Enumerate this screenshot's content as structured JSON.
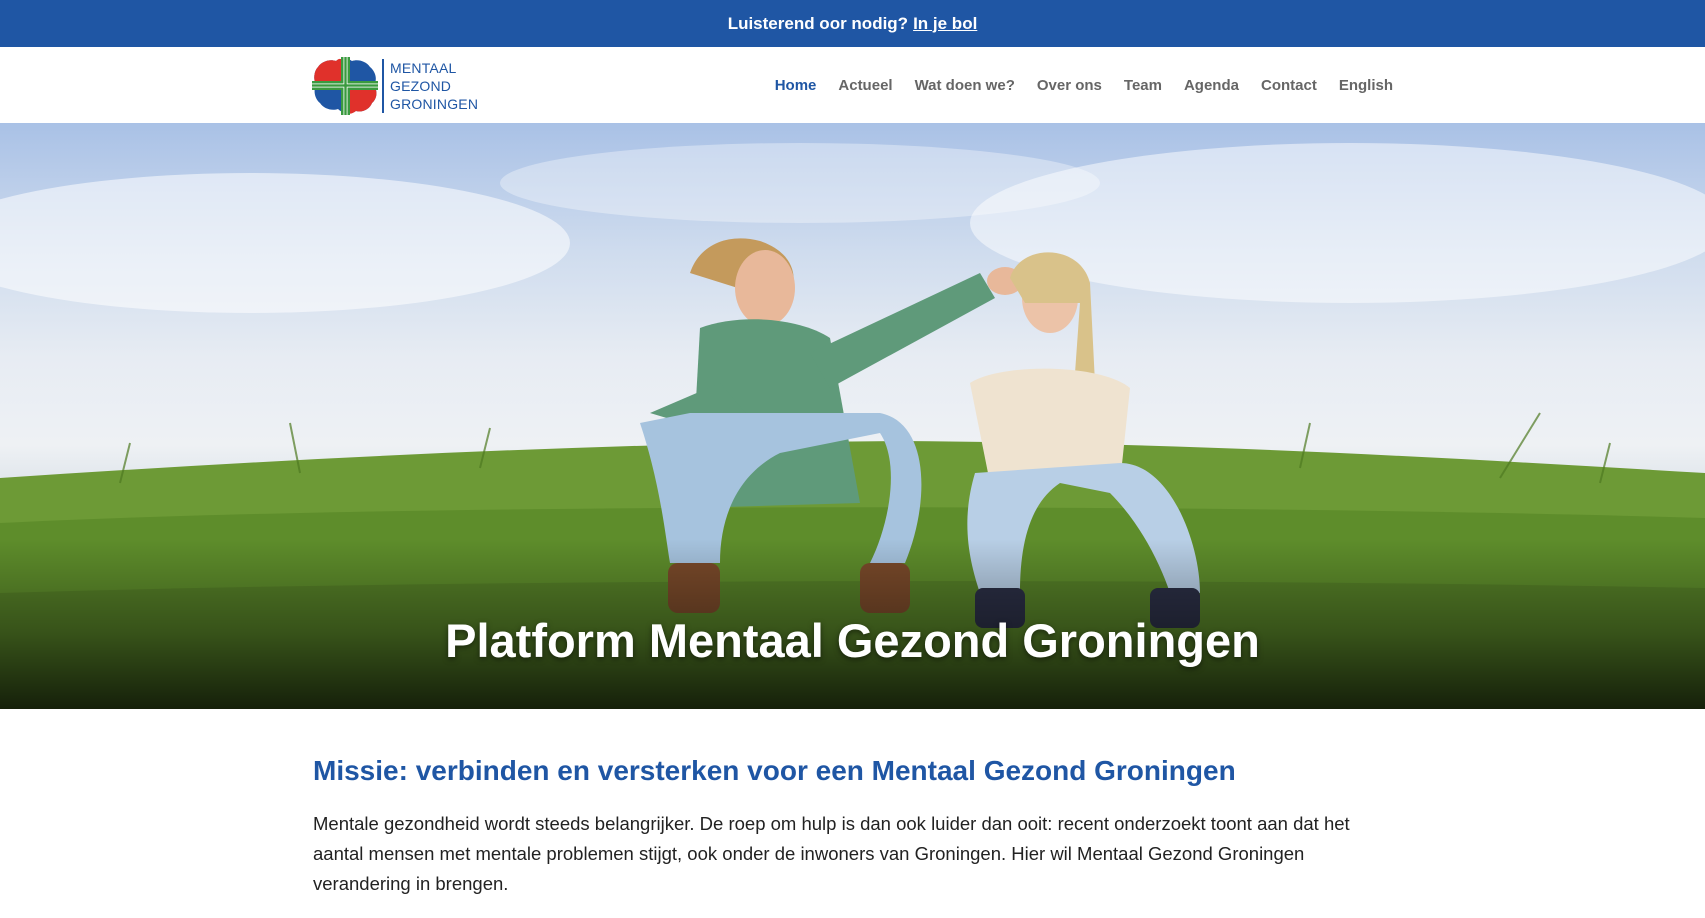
{
  "topbar": {
    "text": "Luisterend oor nodig?",
    "link_label": "In je bol"
  },
  "logo": {
    "line1": "MENTAAL",
    "line2": "GEZOND",
    "line3": "GRONINGEN",
    "colors": {
      "red": "#e0312b",
      "blue": "#1f56a4",
      "green": "#3a9a3f"
    }
  },
  "nav": {
    "items": [
      {
        "label": "Home",
        "active": true
      },
      {
        "label": "Actueel"
      },
      {
        "label": "Wat doen we?"
      },
      {
        "label": "Over ons"
      },
      {
        "label": "Team"
      },
      {
        "label": "Agenda"
      },
      {
        "label": "Contact"
      },
      {
        "label": "English"
      }
    ]
  },
  "hero": {
    "title": "Platform Mentaal Gezond Groningen"
  },
  "mission": {
    "title": "Missie: verbinden en versterken voor een Mentaal Gezond Groningen",
    "text": "Mentale gezondheid wordt steeds belangrijker. De roep om hulp is dan ook luider dan ooit: recent onderzoekt toont aan dat het aantal mensen met mentale problemen stijgt, ook onder de inwoners van Groningen. Hier wil Mentaal Gezond Groningen verandering in brengen."
  },
  "colors": {
    "brand_blue": "#1f56a4",
    "nav_text": "#666666"
  }
}
